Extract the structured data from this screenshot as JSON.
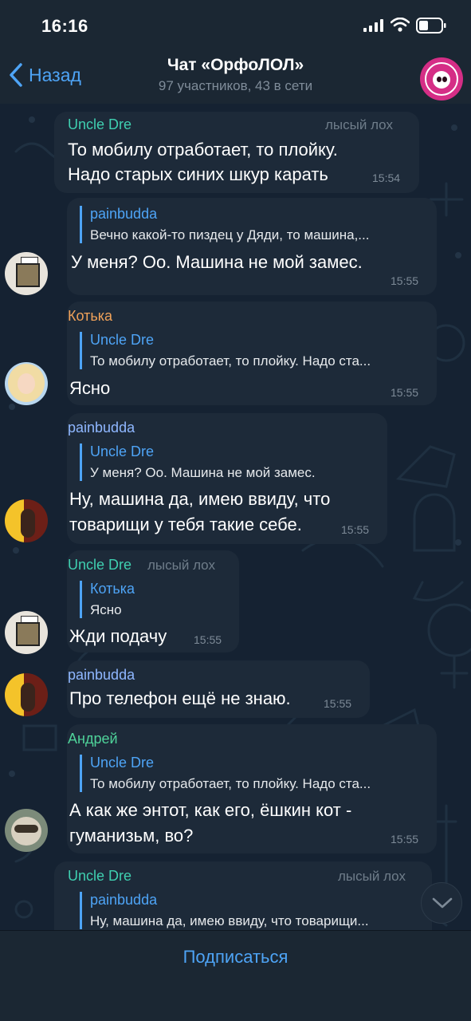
{
  "status_bar": {
    "time": "16:16"
  },
  "header": {
    "back_label": "Назад",
    "title": "Чат «ОрфоЛОЛ»",
    "subtitle": "97 участников, 43 в сети"
  },
  "colors": {
    "accent": "#4ea4f6",
    "uncle_dre": "#3fcfb0",
    "kotka": "#f0a25a",
    "painbudda": "#8fb7ff",
    "andrey": "#4fd39a"
  },
  "messages": [
    {
      "sender": "Uncle Dre",
      "badge": "лысый лох",
      "text1": "То мобилу отработает, то плойку.",
      "text2": "Надо старых синих шкур карать",
      "time": "15:54"
    },
    {
      "reply_name": "painbudda",
      "reply_text": "Вечно какой-то пиздец у Дяди, то машина,...",
      "text1": "У меня? Оо. Машина не мой замес.",
      "time": "15:55"
    },
    {
      "sender": "Котька",
      "reply_name": "Uncle Dre",
      "reply_text": "То мобилу отработает, то плойку. Надо ста...",
      "text1": "Ясно",
      "time": "15:55"
    },
    {
      "sender": "painbudda",
      "reply_name": "Uncle Dre",
      "reply_text": "У меня? Оо. Машина не мой замес.",
      "text1": "Ну, машина да, имею ввиду, что",
      "text2": "товарищи у тебя такие себе.",
      "time": "15:55"
    },
    {
      "sender": "Uncle Dre",
      "badge": "лысый лох",
      "reply_name": "Котька",
      "reply_text": "Ясно",
      "text1": "Жди подачу",
      "time": "15:55"
    },
    {
      "sender": "painbudda",
      "text1": "Про телефон ещё не знаю.",
      "time": "15:55"
    },
    {
      "sender": "Андрей",
      "reply_name": "Uncle Dre",
      "reply_text": "То мобилу отработает, то плойку. Надо ста...",
      "text1": "А как же энтот, как его, ёшкин кот -",
      "text2": "гуманизьм, во?",
      "time": "15:55"
    },
    {
      "sender": "Uncle Dre",
      "badge": "лысый лох",
      "reply_name": "painbudda",
      "reply_text": "Ну, машина да, имею ввиду, что товарищи..."
    }
  ],
  "icons": {
    "back": "chevron-left-icon",
    "scroll": "chevron-down-icon",
    "signal": "signal-icon",
    "wifi": "wifi-icon",
    "battery": "battery-icon"
  },
  "footer": {
    "subscribe_label": "Подписаться"
  }
}
